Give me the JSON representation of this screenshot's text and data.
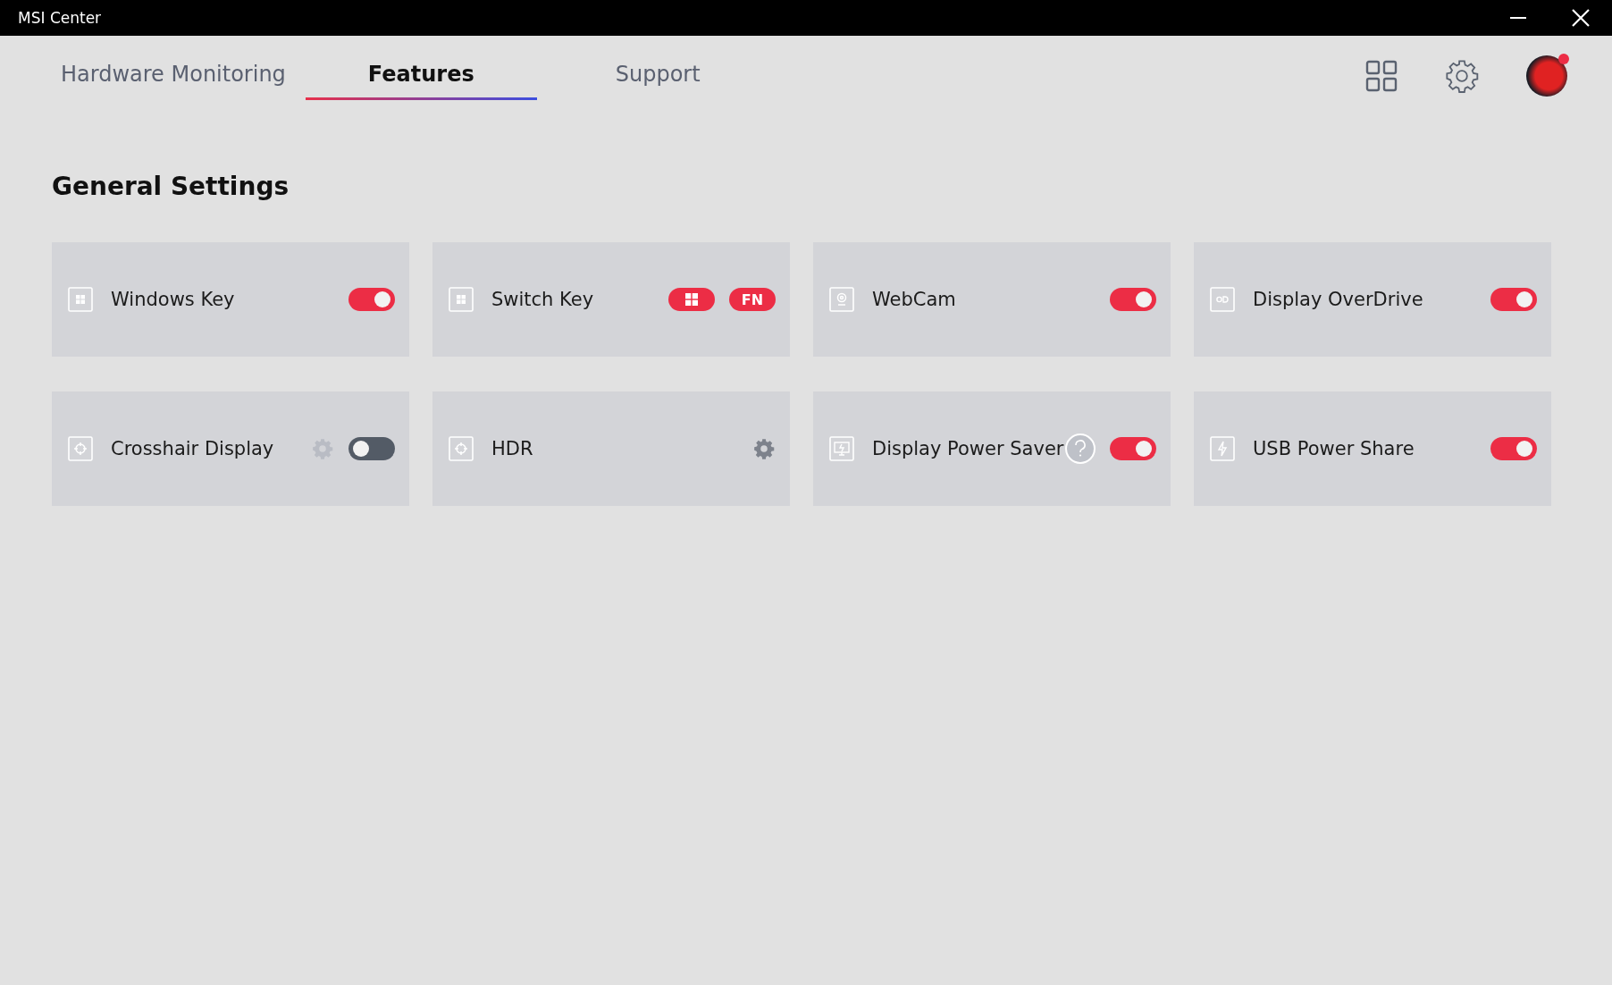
{
  "window": {
    "title": "MSI Center"
  },
  "tabs": [
    {
      "label": "Hardware Monitoring",
      "selected": false
    },
    {
      "label": "Features",
      "selected": true
    },
    {
      "label": "Support",
      "selected": false
    }
  ],
  "header_badge": {
    "notification": true
  },
  "section_title": "General Settings",
  "cards": [
    {
      "label": "Windows Key",
      "controls": [
        {
          "kind": "toggle",
          "on": true
        }
      ]
    },
    {
      "label": "Switch Key",
      "controls": [
        {
          "kind": "windows-pill"
        },
        {
          "kind": "text-pill",
          "label": "FN"
        }
      ]
    },
    {
      "label": "WebCam",
      "controls": [
        {
          "kind": "toggle",
          "on": true
        }
      ]
    },
    {
      "label": "Display OverDrive",
      "controls": [
        {
          "kind": "toggle",
          "on": true
        }
      ]
    },
    {
      "label": "Crosshair Display",
      "controls": [
        {
          "kind": "gear",
          "disabled": true
        },
        {
          "kind": "toggle",
          "on": false
        }
      ]
    },
    {
      "label": "HDR",
      "controls": [
        {
          "kind": "gear",
          "disabled": false
        }
      ]
    },
    {
      "label": "Display Power Saver",
      "controls": [
        {
          "kind": "help"
        },
        {
          "kind": "toggle",
          "on": true
        }
      ]
    },
    {
      "label": "USB Power Share",
      "controls": [
        {
          "kind": "toggle",
          "on": true
        }
      ]
    }
  ]
}
